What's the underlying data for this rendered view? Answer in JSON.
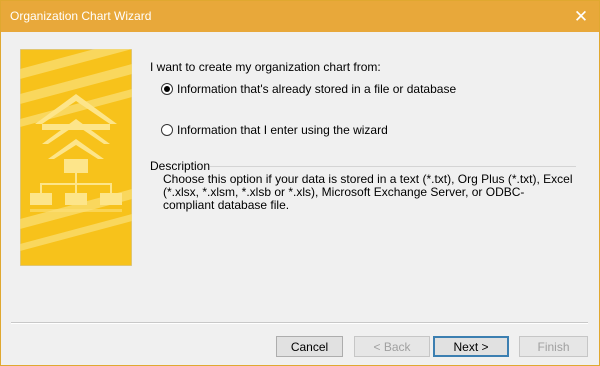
{
  "window": {
    "title": "Organization Chart Wizard",
    "close_glyph": "✕"
  },
  "main": {
    "prompt": "I want to create my organization chart from:",
    "options": [
      {
        "label": "Information that's already stored in a file or database",
        "selected": true
      },
      {
        "label": "Information that I enter using the wizard",
        "selected": false
      }
    ],
    "description_heading": "Description",
    "description_text": "Choose this option if your data is stored in a text (*.txt), Org Plus (*.txt), Excel (*.xlsx, *.xlsm, *.xlsb or *.xls), Microsoft Exchange Server, or ODBC-compliant database file."
  },
  "buttons": {
    "cancel": "Cancel",
    "back": "< Back",
    "next": "Next >",
    "finish": "Finish"
  },
  "colors": {
    "title_bar": "#e8a83a",
    "art_yellow": "#f7c21b",
    "art_light": "#fbe07a"
  },
  "icons": {
    "close": "close-icon",
    "art": "org-chart-wizard-graphic"
  }
}
